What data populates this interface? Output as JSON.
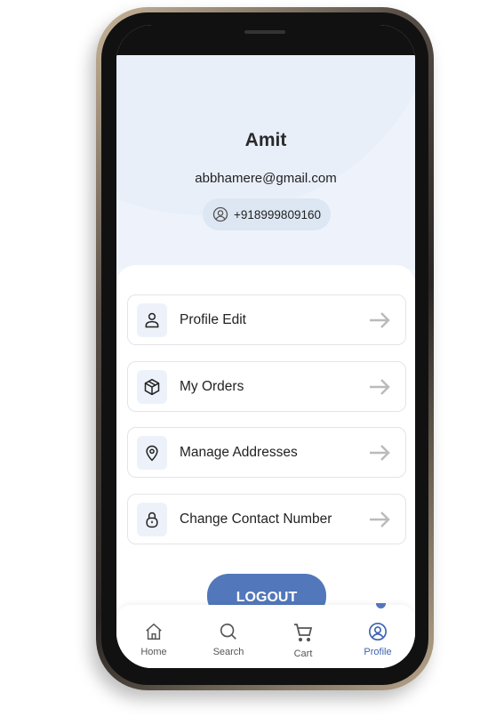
{
  "profile": {
    "name": "Amit",
    "email": "abbhamere@gmail.com",
    "phone": "+918999809160"
  },
  "menu": [
    {
      "label": "Profile Edit",
      "icon": "user-icon"
    },
    {
      "label": "My Orders",
      "icon": "box-icon"
    },
    {
      "label": "Manage Addresses",
      "icon": "location-pin-icon"
    },
    {
      "label": "Change Contact Number",
      "icon": "lock-icon"
    }
  ],
  "logout_label": "LOGOUT",
  "nav": [
    {
      "label": "Home",
      "icon": "home-icon"
    },
    {
      "label": "Search",
      "icon": "search-icon"
    },
    {
      "label": "Cart",
      "icon": "cart-icon"
    },
    {
      "label": "Profile",
      "icon": "profile-icon",
      "active": true
    }
  ],
  "colors": {
    "accent": "#5277bb"
  }
}
